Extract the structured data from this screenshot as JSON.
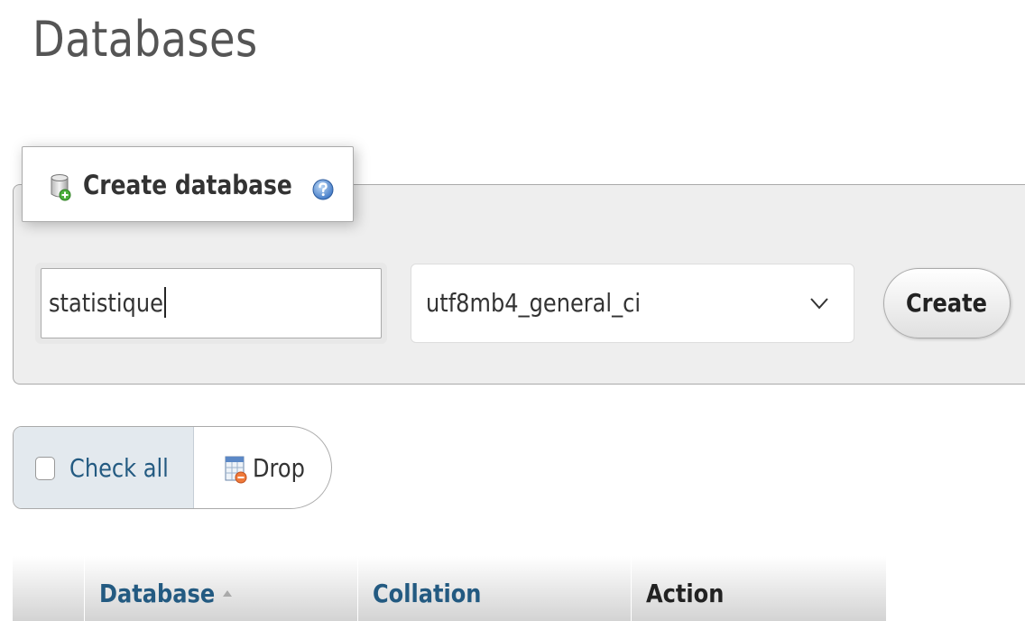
{
  "page": {
    "title": "Databases"
  },
  "create_database": {
    "legend_label": "Create database",
    "name_value": "statistique",
    "collation_selected": "utf8mb4_general_ci",
    "create_button_label": "Create"
  },
  "bulk_actions": {
    "check_all_label": "Check all",
    "check_all_checked": false,
    "drop_label": "Drop"
  },
  "table": {
    "columns": [
      {
        "label": "Database",
        "sortable": true,
        "sort": "ascending"
      },
      {
        "label": "Collation",
        "sortable": true
      },
      {
        "label": "Action",
        "sortable": false
      }
    ]
  },
  "icons": {
    "legend_icon": "database-add-icon",
    "help_icon": "help-icon",
    "select_arrow": "chevron-down-icon",
    "drop_icon": "database-drop-icon",
    "sort_icon": "sort-ascending-icon"
  },
  "colors": {
    "link": "#235a81",
    "fieldset_background": "#eeeeee",
    "check_all_background": "#e3e9ee"
  }
}
